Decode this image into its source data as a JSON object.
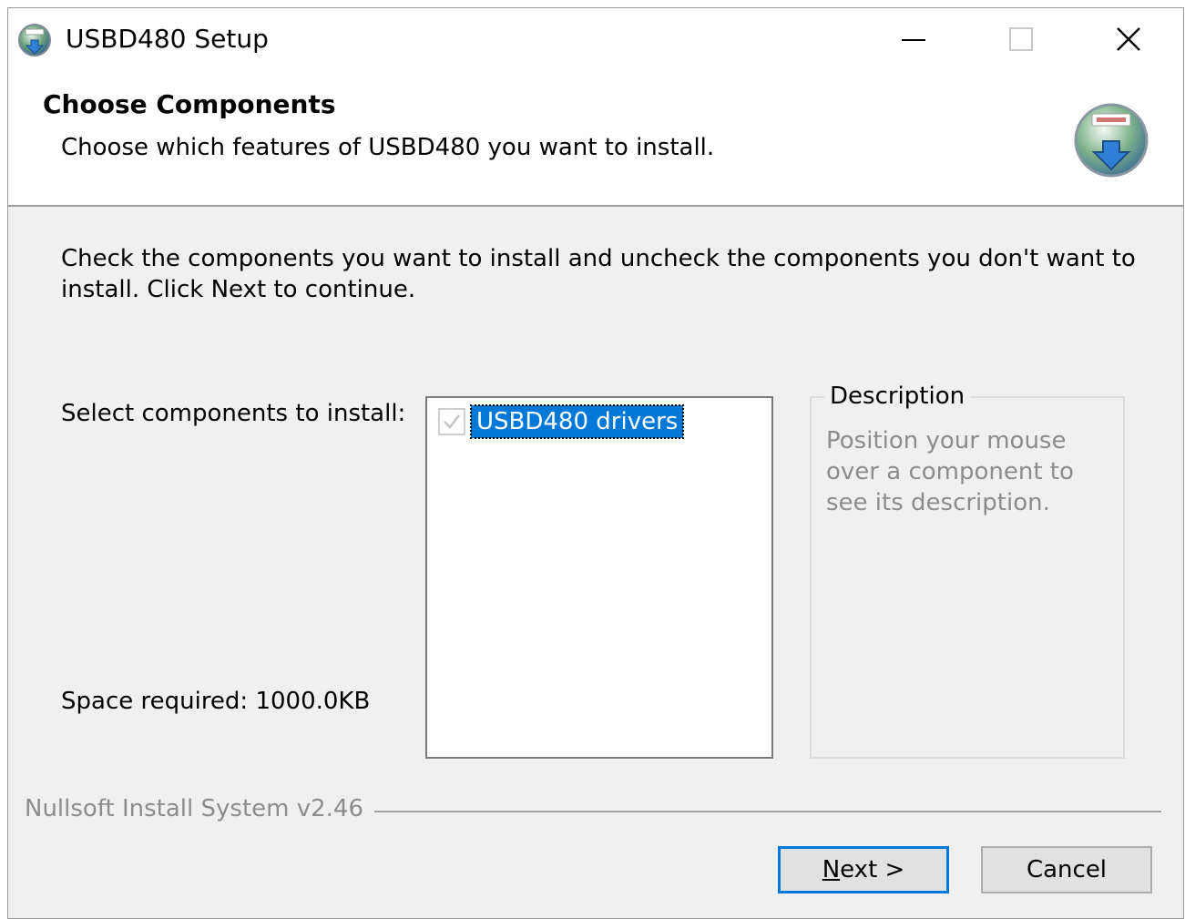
{
  "window": {
    "title": "USBD480 Setup",
    "controls": {
      "minimize_icon": "minimize-icon",
      "maximize_icon": "maximize-icon",
      "close_icon": "close-icon"
    }
  },
  "header": {
    "title": "Choose Components",
    "subtitle": "Choose which features of USBD480 you want to install.",
    "logo_icon": "installer-logo-icon"
  },
  "body": {
    "intro": "Check the components you want to install and uncheck the components you don't want to install. Click Next to continue.",
    "select_label": "Select components to install:",
    "space_required": "Space required: 1000.0KB"
  },
  "components": [
    {
      "label": "USBD480 drivers",
      "checked": true,
      "disabled": true,
      "selected": true
    }
  ],
  "description": {
    "title": "Description",
    "text": "Position your mouse over a component to see its description."
  },
  "footer": {
    "branding": "Nullsoft Install System v2.46",
    "next_mnemonic": "N",
    "next_rest": "ext >",
    "cancel_label": "Cancel"
  },
  "colors": {
    "accent": "#0078d7",
    "dialog_bg": "#f0f0f0",
    "disabled_text": "#8c8c8c"
  }
}
